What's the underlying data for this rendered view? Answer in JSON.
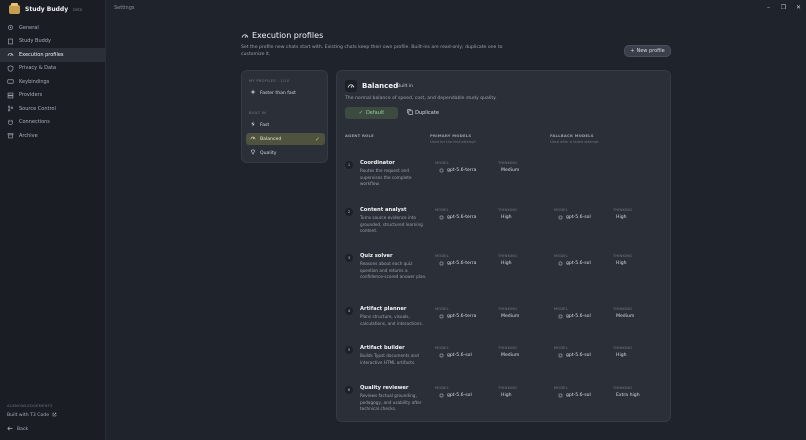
{
  "app": {
    "name": "Study Buddy",
    "tag": "beta",
    "window_title": "Settings"
  },
  "sidebar": {
    "items": [
      {
        "label": "General",
        "icon": "gear-icon",
        "active": false
      },
      {
        "label": "Study Buddy",
        "icon": "book-icon",
        "active": false
      },
      {
        "label": "Execution profiles",
        "icon": "gauge-icon",
        "active": true
      },
      {
        "label": "Privacy & Data",
        "icon": "shield-icon",
        "active": false
      },
      {
        "label": "Keybindings",
        "icon": "keyboard-icon",
        "active": false
      },
      {
        "label": "Providers",
        "icon": "server-icon",
        "active": false
      },
      {
        "label": "Source Control",
        "icon": "branch-icon",
        "active": false
      },
      {
        "label": "Connections",
        "icon": "plug-icon",
        "active": false
      },
      {
        "label": "Archive",
        "icon": "archive-icon",
        "active": false
      }
    ],
    "ack_title": "ACKNOWLEDGEMENTS",
    "ack_link": "Built with T3 Code",
    "back_label": "Back"
  },
  "page": {
    "title": "Execution profiles",
    "description": "Set the profile new chats start with. Existing chats keep their own profile. Built-ins are read-only; duplicate one to customize it.",
    "new_button": "New profile"
  },
  "profiles": {
    "my_label": "MY PROFILES · 1/10",
    "my_items": [
      {
        "label": "Faster than fast"
      }
    ],
    "builtin_label": "BUILT IN",
    "builtin_items": [
      {
        "label": "Fast",
        "active": false
      },
      {
        "label": "Balanced",
        "active": true
      },
      {
        "label": "Quality",
        "active": false
      }
    ]
  },
  "detail": {
    "title": "Balanced",
    "badge": "Built in",
    "description": "The normal balance of speed, cost, and dependable study quality.",
    "default_button": "Default",
    "duplicate_button": "Duplicate",
    "col_role": "AGENT ROLE",
    "col_primary": "PRIMARY MODELS",
    "col_primary_sub": "Used for the first attempt",
    "col_fallback": "FALLBACK MODELS",
    "col_fallback_sub": "Used after a failed attempt",
    "label_model": "MODEL",
    "label_thinking": "THINKING",
    "roles": [
      {
        "num": "1",
        "name": "Coordinator",
        "desc": "Routes the request and supervises the complete workflow.",
        "p_model": "gpt-5.6-terra",
        "p_think": "Medium",
        "f_model": "",
        "f_think": ""
      },
      {
        "num": "2",
        "name": "Content analyst",
        "desc": "Turns source evidence into grounded, structured learning content.",
        "p_model": "gpt-5.6-terra",
        "p_think": "High",
        "f_model": "gpt-5.6-sol",
        "f_think": "High"
      },
      {
        "num": "3",
        "name": "Quiz solver",
        "desc": "Reasons about each quiz question and returns a confidence-scored answer plan.",
        "p_model": "gpt-5.6-terra",
        "p_think": "High",
        "f_model": "gpt-5.6-sol",
        "f_think": "High"
      },
      {
        "num": "4",
        "name": "Artifact planner",
        "desc": "Plans structure, visuals, calculations, and interactions.",
        "p_model": "gpt-5.6-terra",
        "p_think": "Medium",
        "f_model": "gpt-5.6-sol",
        "f_think": "Medium"
      },
      {
        "num": "5",
        "name": "Artifact builder",
        "desc": "Builds Typst documents and interactive HTML artifacts.",
        "p_model": "gpt-5.6-sol",
        "p_think": "Medium",
        "f_model": "gpt-5.6-sol",
        "f_think": "High"
      },
      {
        "num": "6",
        "name": "Quality reviewer",
        "desc": "Reviews factual grounding, pedagogy, and usability after technical checks.",
        "p_model": "gpt-5.6-sol",
        "p_think": "High",
        "f_model": "gpt-5.6-sol",
        "f_think": "Extra high"
      }
    ]
  }
}
